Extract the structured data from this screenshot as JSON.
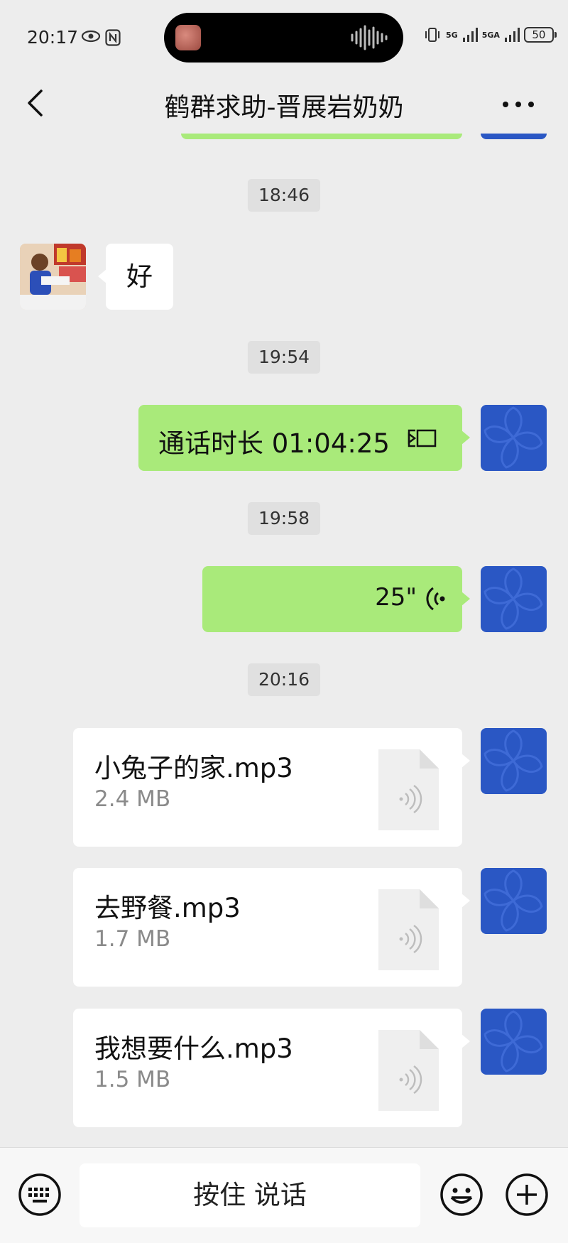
{
  "status_bar": {
    "time": "20:17",
    "network_1": "5G",
    "network_2": "5GA",
    "battery": "50"
  },
  "header": {
    "title": "鹤群求助-晋展岩奶奶"
  },
  "messages": {
    "ts1": "18:46",
    "msg1_text": "好",
    "ts2": "19:54",
    "call_text": "通话时长 01:04:25",
    "ts3": "19:58",
    "voice_duration": "25\"",
    "ts4": "20:16",
    "files": [
      {
        "name": "小兔子的家.mp3",
        "size": "2.4 MB"
      },
      {
        "name": "去野餐.mp3",
        "size": "1.7 MB"
      },
      {
        "name": "我想要什么.mp3",
        "size": "1.5 MB"
      }
    ]
  },
  "input_bar": {
    "talk_label": "按住 说话"
  },
  "colors": {
    "bubble_green": "#a9ea7a",
    "avatar_blue": "#2a57c4",
    "background": "#ededed"
  },
  "icons": [
    "eye-icon",
    "nfc-icon",
    "vibrate-icon",
    "signal-icon",
    "battery-icon",
    "back-icon",
    "more-icon",
    "video-call-icon",
    "voice-wave-icon",
    "audio-file-icon",
    "keyboard-icon",
    "emoji-icon",
    "plus-icon"
  ]
}
